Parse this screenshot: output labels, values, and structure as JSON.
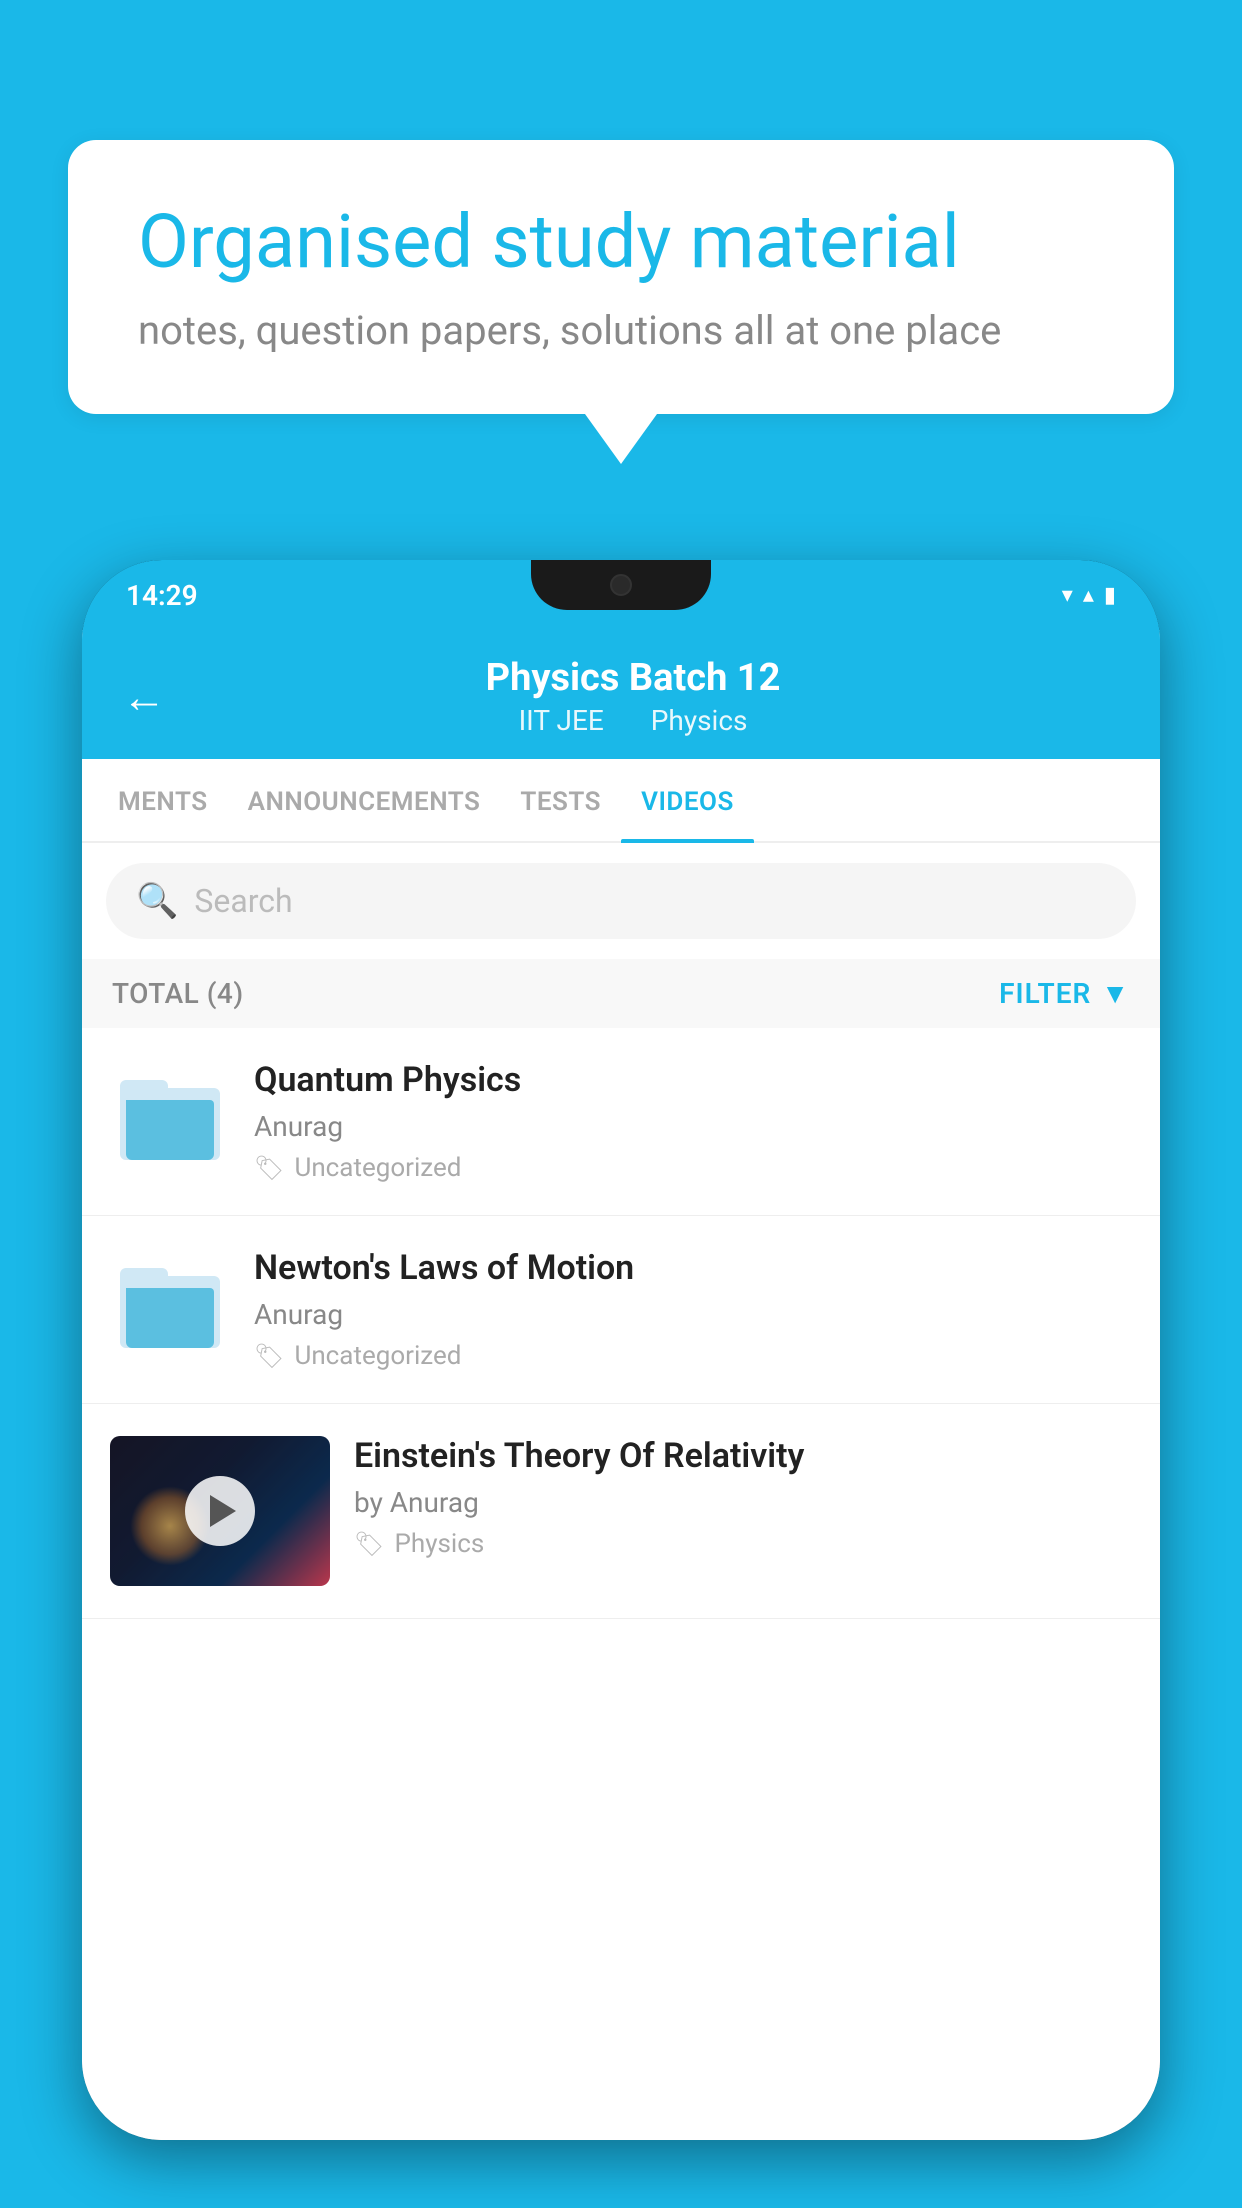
{
  "background_color": "#1ab8e8",
  "speech_bubble": {
    "title": "Organised study material",
    "subtitle": "notes, question papers, solutions all at one place"
  },
  "phone": {
    "status_bar": {
      "time": "14:29"
    },
    "header": {
      "back_label": "←",
      "title": "Physics Batch 12",
      "subtitle_part1": "IIT JEE",
      "subtitle_part2": "Physics"
    },
    "tabs": [
      {
        "label": "MENTS",
        "active": false
      },
      {
        "label": "ANNOUNCEMENTS",
        "active": false
      },
      {
        "label": "TESTS",
        "active": false
      },
      {
        "label": "VIDEOS",
        "active": true
      }
    ],
    "search": {
      "placeholder": "Search"
    },
    "filter_row": {
      "total_label": "TOTAL (4)",
      "filter_label": "FILTER"
    },
    "videos": [
      {
        "id": 1,
        "title": "Quantum Physics",
        "author": "Anurag",
        "tag": "Uncategorized",
        "type": "folder"
      },
      {
        "id": 2,
        "title": "Newton's Laws of Motion",
        "author": "Anurag",
        "tag": "Uncategorized",
        "type": "folder"
      },
      {
        "id": 3,
        "title": "Einstein's Theory Of Relativity",
        "author": "by Anurag",
        "tag": "Physics",
        "type": "video"
      }
    ]
  }
}
